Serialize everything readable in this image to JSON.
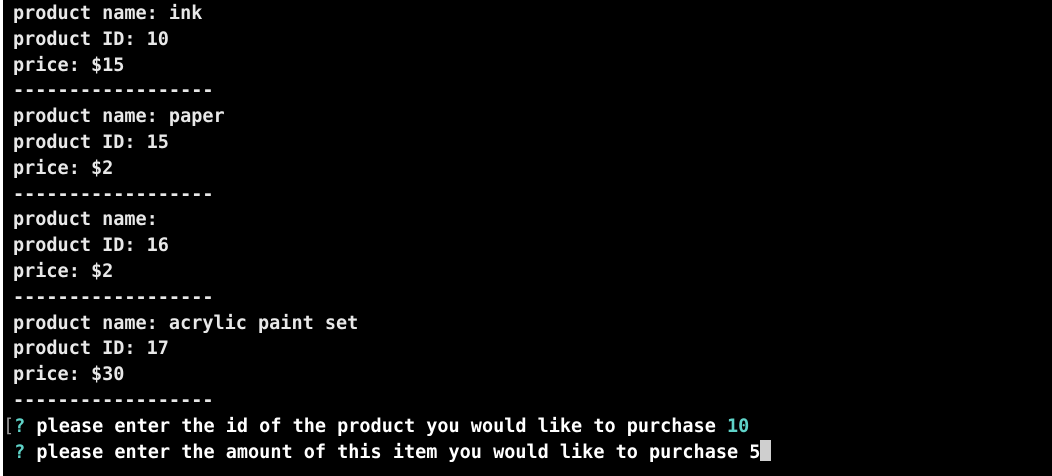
{
  "products": [
    {
      "name_line": "product name: ink",
      "id_line": "product ID: 10",
      "price_line": "price: $15"
    },
    {
      "name_line": "product name: paper",
      "id_line": "product ID: 15",
      "price_line": "price: $2"
    },
    {
      "name_line": "product name:",
      "id_line": "product ID: 16",
      "price_line": "price: $2"
    },
    {
      "name_line": "product name: acrylic paint set",
      "id_line": "product ID: 17",
      "price_line": "price: $30"
    }
  ],
  "separator": "------------------",
  "prompts": [
    {
      "bracket": "[",
      "symbol": "?",
      "question": "please enter the id of the product you would like to purchase",
      "answer": "10"
    },
    {
      "bracket": " ",
      "symbol": "?",
      "question": "please enter the amount of this item you would like to purchase",
      "answer": "5"
    }
  ],
  "colors": {
    "background": "#000000",
    "text": "#e8e8e8",
    "accent": "#5fd3c8"
  }
}
